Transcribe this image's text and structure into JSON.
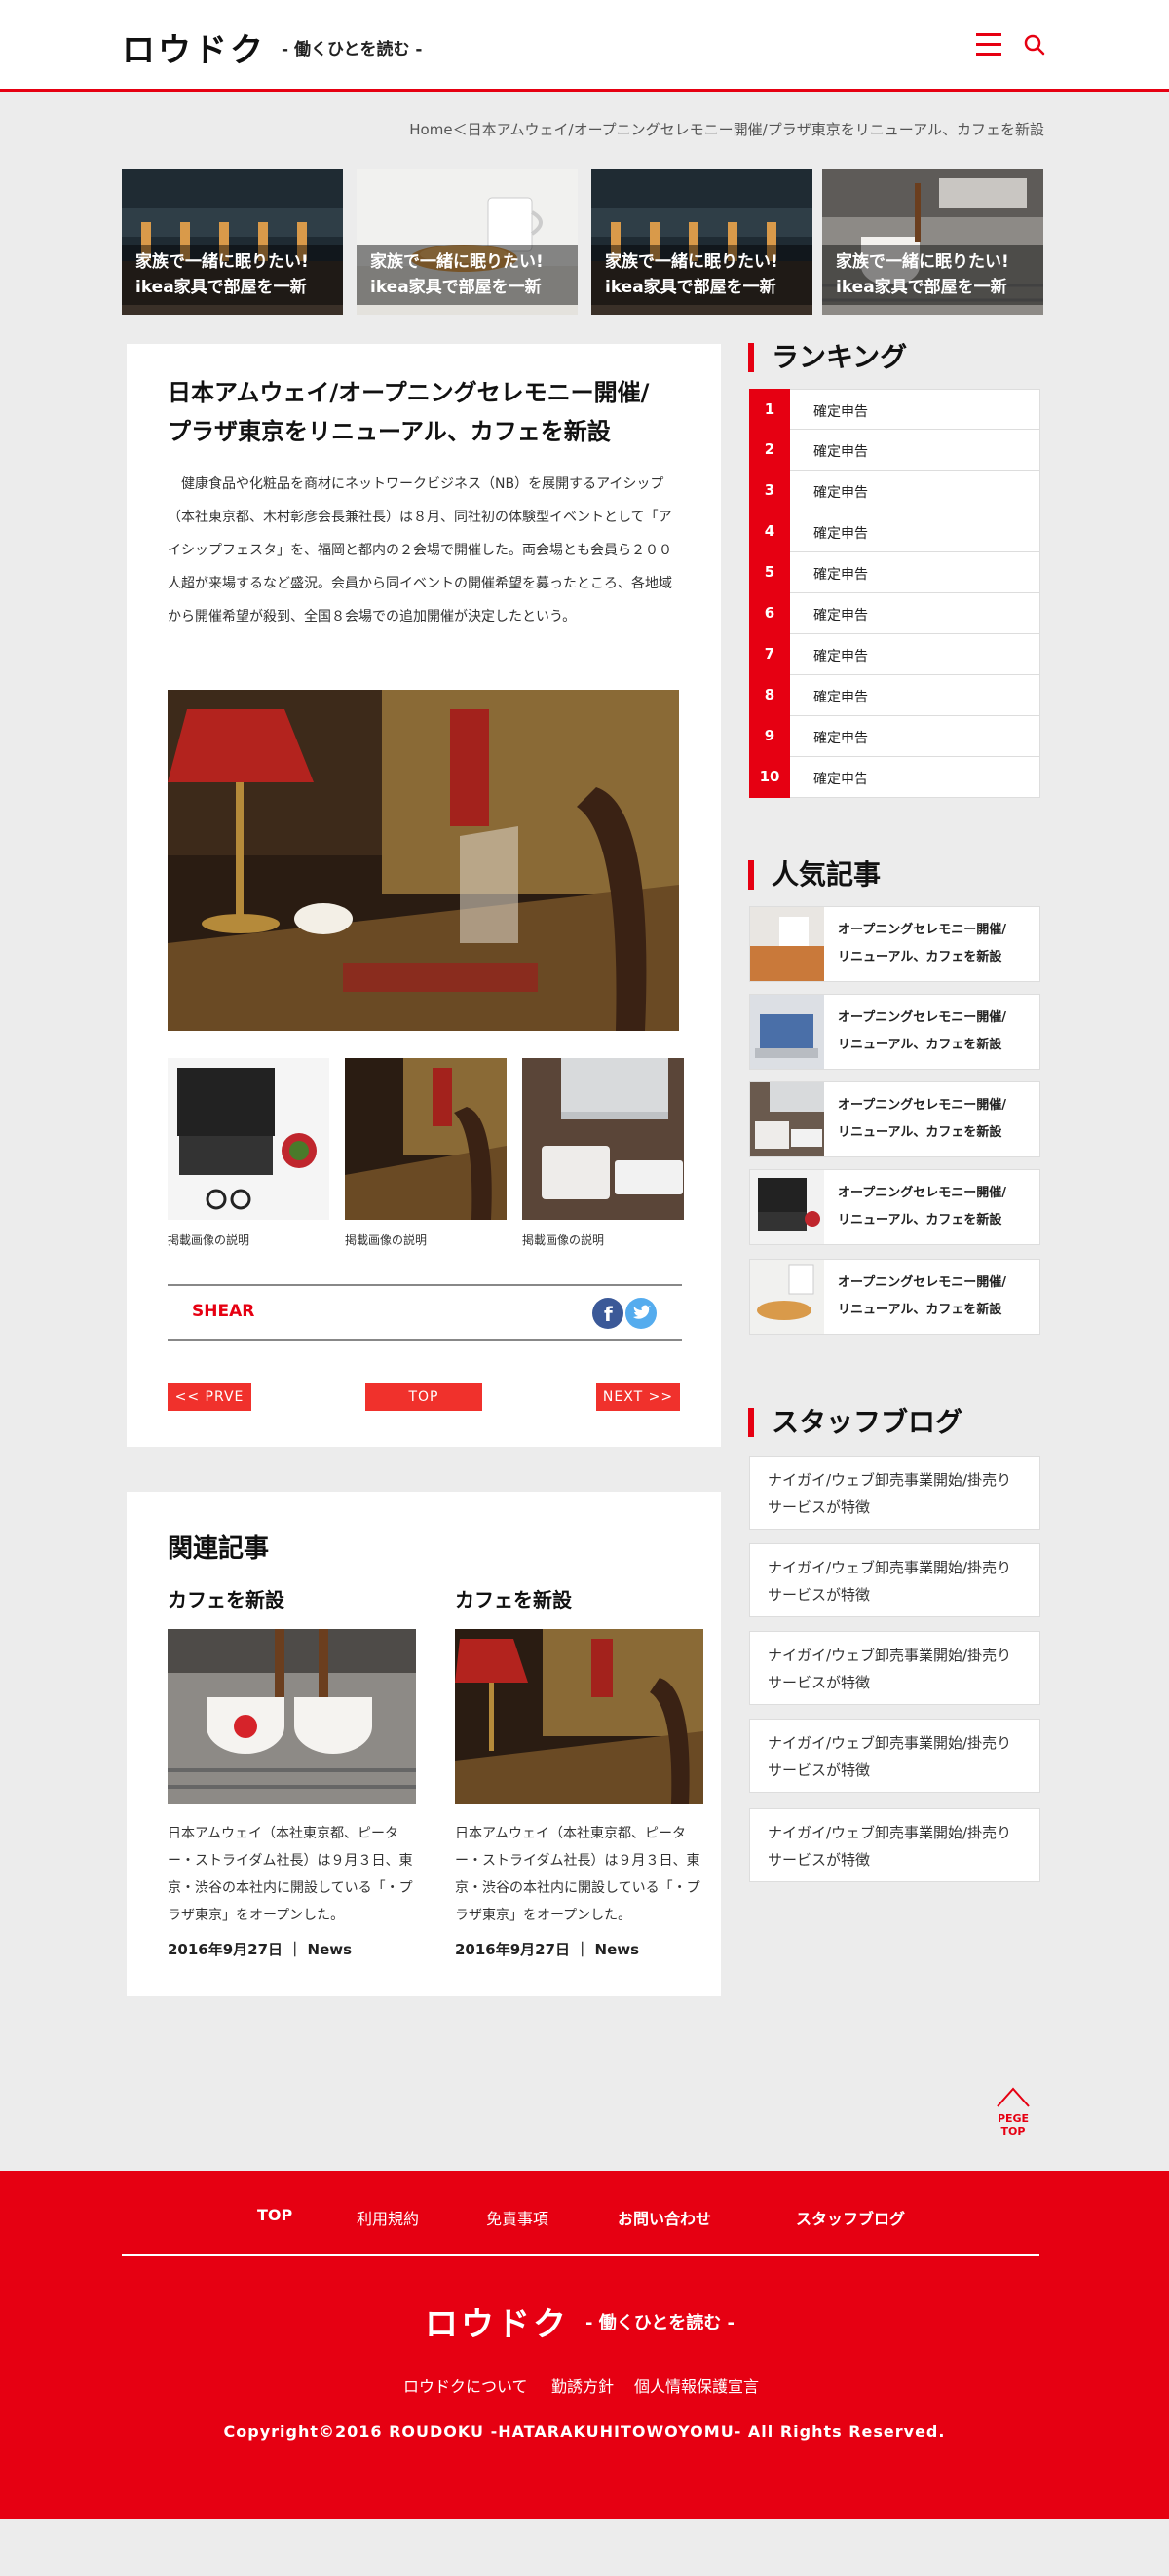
{
  "header": {
    "logo": "ロウドク",
    "tagline": "- 働くひとを読む -"
  },
  "breadcrumb": "Home＜日本アムウェイ/オープニングセレモニー開催/プラザ東京をリニューアル、カフェを新設",
  "features": [
    {
      "line1": "家族で一緒に眠りたい!",
      "line2": "ikea家具で部屋を一新"
    },
    {
      "line1": "家族で一緒に眠りたい!",
      "line2": "ikea家具で部屋を一新"
    },
    {
      "line1": "家族で一緒に眠りたい!",
      "line2": "ikea家具で部屋を一新"
    },
    {
      "line1": "家族で一緒に眠りたい!",
      "line2": "ikea家具で部屋を一新"
    }
  ],
  "article": {
    "title_line1": "日本アムウェイ/オープニングセレモニー開催/",
    "title_line2": "プラザ東京をリニューアル、カフェを新設",
    "body": "健康食品や化粧品を商材にネットワークビジネス（NB）を展開するアイシップ（本社東京都、木村彰彦会長兼社長）は８月、同社初の体験型イベントとして「アイシップフェスタ」を、福岡と都内の２会場で開催した。両会場とも会員ら２００人超が来場するなど盛況。会員から同イベントの開催希望を募ったところ、各地域から開催希望が殺到、全国８会場での追加開催が決定したという。",
    "thumb_captions": [
      "掲載画像の説明",
      "掲載画像の説明",
      "掲載画像の説明"
    ],
    "share_label": "SHEAR",
    "prev_label": "<< PRVE",
    "top_label": "TOP",
    "next_label": "NEXT >>"
  },
  "related": {
    "heading": "関連記事",
    "items": [
      {
        "title": "カフェを新設",
        "desc": "日本アムウェイ（本社東京都、ピーター・ストライダム社長）は９月３日、東京・渋谷の本社内に開設している「・プラザ東京」をオープンした。",
        "date": "2016年9月27日",
        "category": "News"
      },
      {
        "title": "カフェを新設",
        "desc": "日本アムウェイ（本社東京都、ピーター・ストライダム社長）は９月３日、東京・渋谷の本社内に開設している「・プラザ東京」をオープンした。",
        "date": "2016年9月27日",
        "category": "News"
      }
    ]
  },
  "ranking": {
    "heading": "ランキング",
    "items": [
      {
        "num": "1",
        "label": "確定申告"
      },
      {
        "num": "2",
        "label": "確定申告"
      },
      {
        "num": "3",
        "label": "確定申告"
      },
      {
        "num": "4",
        "label": "確定申告"
      },
      {
        "num": "5",
        "label": "確定申告"
      },
      {
        "num": "6",
        "label": "確定申告"
      },
      {
        "num": "7",
        "label": "確定申告"
      },
      {
        "num": "8",
        "label": "確定申告"
      },
      {
        "num": "9",
        "label": "確定申告"
      },
      {
        "num": "10",
        "label": "確定申告"
      }
    ]
  },
  "popular": {
    "heading": "人気記事",
    "items": [
      {
        "line1": "オープニングセレモニー開催/",
        "line2": "リニューアル、カフェを新設"
      },
      {
        "line1": "オープニングセレモニー開催/",
        "line2": "リニューアル、カフェを新設"
      },
      {
        "line1": "オープニングセレモニー開催/",
        "line2": "リニューアル、カフェを新設"
      },
      {
        "line1": "オープニングセレモニー開催/",
        "line2": "リニューアル、カフェを新設"
      },
      {
        "line1": "オープニングセレモニー開催/",
        "line2": "リニューアル、カフェを新設"
      }
    ]
  },
  "staff_blog": {
    "heading": "スタッフブログ",
    "items": [
      {
        "line1": "ナイガイ/ウェブ卸売事業開始/掛売り",
        "line2": "サービスが特徴"
      },
      {
        "line1": "ナイガイ/ウェブ卸売事業開始/掛売り",
        "line2": "サービスが特徴"
      },
      {
        "line1": "ナイガイ/ウェブ卸売事業開始/掛売り",
        "line2": "サービスが特徴"
      },
      {
        "line1": "ナイガイ/ウェブ卸売事業開始/掛売り",
        "line2": "サービスが特徴"
      },
      {
        "line1": "ナイガイ/ウェブ卸売事業開始/掛売り",
        "line2": "サービスが特徴"
      }
    ]
  },
  "page_top_label": "PEGE TOP",
  "footer": {
    "nav": [
      "TOP",
      "利用規約",
      "免責事項",
      "お問い合わせ",
      "スタッフブログ"
    ],
    "logo": "ロウドク",
    "tagline": "- 働くひとを読む -",
    "links": [
      "ロウドクについて",
      "勤誘方針",
      "個人情報保護宣言"
    ],
    "copyright": "Copyright©2016 ROUDOKU -HATARAKUHITOWOYOMU- All Rights Reserved."
  },
  "colors": {
    "accent": "#e60012",
    "button": "#f0312c",
    "background": "#ececec"
  }
}
